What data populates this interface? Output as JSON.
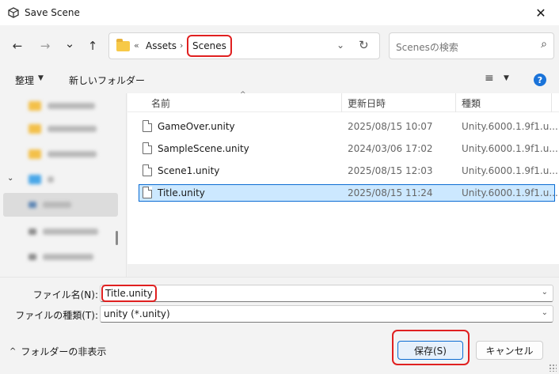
{
  "window": {
    "title": "Save Scene",
    "app_icon": "unity-icon",
    "close_glyph": "✕"
  },
  "navigation": {
    "back_glyph": "←",
    "forward_glyph": "→",
    "recent_glyph": "⌄",
    "up_glyph": "↑"
  },
  "address_bar": {
    "overflow_glyph": "«",
    "crumbs": [
      "Assets",
      "Scenes"
    ],
    "separator_glyph": "›",
    "dropdown_glyph": "⌄",
    "refresh_glyph": "↻"
  },
  "search": {
    "placeholder": "Scenesの検索",
    "icon_glyph": "⌕"
  },
  "toolbar": {
    "organize_label": "整理",
    "organize_chevron": "▼",
    "new_folder_label": "新しいフォルダー",
    "view_glyph": "≡",
    "view_chevron": "▼",
    "help_glyph": "?"
  },
  "columns": {
    "name": "名前",
    "date": "更新日時",
    "type": "種類",
    "sort_glyph": "^"
  },
  "files": [
    {
      "name": "GameOver.unity",
      "date": "2025/08/15 10:07",
      "type": "Unity.6000.1.9f1.u...",
      "selected": false
    },
    {
      "name": "SampleScene.unity",
      "date": "2024/03/06 17:02",
      "type": "Unity.6000.1.9f1.u...",
      "selected": false
    },
    {
      "name": "Scene1.unity",
      "date": "2025/08/15 12:03",
      "type": "Unity.6000.1.9f1.u...",
      "selected": false
    },
    {
      "name": "Title.unity",
      "date": "2025/08/15 11:24",
      "type": "Unity.6000.1.9f1.u...",
      "selected": true
    }
  ],
  "filename_field": {
    "label": "ファイル名(N):",
    "value": "Title.unity",
    "chevron": "⌄"
  },
  "filetype_field": {
    "label": "ファイルの種類(T):",
    "value": "unity (*.unity)",
    "chevron": "⌄"
  },
  "footer": {
    "hide_folders_chevron": "^",
    "hide_folders_label": "フォルダーの非表示",
    "save_label": "保存(S)",
    "cancel_label": "キャンセル"
  },
  "colors": {
    "accent": "#0b6cd3",
    "highlight_red": "#e02020",
    "selection_bg": "#cce8ff"
  }
}
